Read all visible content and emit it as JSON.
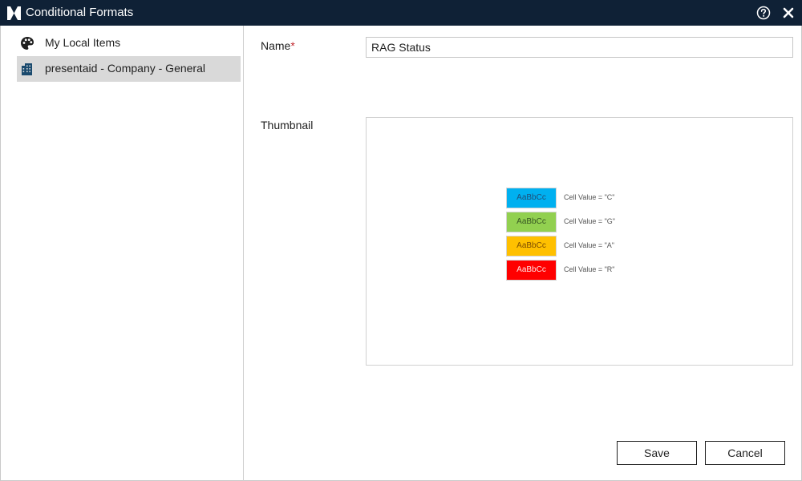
{
  "window": {
    "title": "Conditional Formats"
  },
  "sidebar": {
    "items": [
      {
        "label": "My Local Items",
        "icon": "palette-icon",
        "selected": false
      },
      {
        "label": "presentaid - Company - General",
        "icon": "building-icon",
        "selected": true
      }
    ]
  },
  "form": {
    "name_label": "Name",
    "required_mark": "*",
    "name_value": "RAG Status",
    "thumbnail_label": "Thumbnail"
  },
  "thumbnail": {
    "rules": [
      {
        "sample": "AaBbCc",
        "condition": "Cell Value = \"C\"",
        "fill": "#00b0f0",
        "text_color": "#1f4e79"
      },
      {
        "sample": "AaBbCc",
        "condition": "Cell Value = \"G\"",
        "fill": "#92d050",
        "text_color": "#375623"
      },
      {
        "sample": "AaBbCc",
        "condition": "Cell Value = \"A\"",
        "fill": "#ffc000",
        "text_color": "#7f4f00"
      },
      {
        "sample": "AaBbCc",
        "condition": "Cell Value = \"R\"",
        "fill": "#ff0000",
        "text_color": "#ffe0e0"
      }
    ]
  },
  "buttons": {
    "save": "Save",
    "cancel": "Cancel"
  },
  "colors": {
    "titlebar": "#0f2136",
    "selected_item": "#d9d9d9",
    "required": "#c0262d"
  }
}
